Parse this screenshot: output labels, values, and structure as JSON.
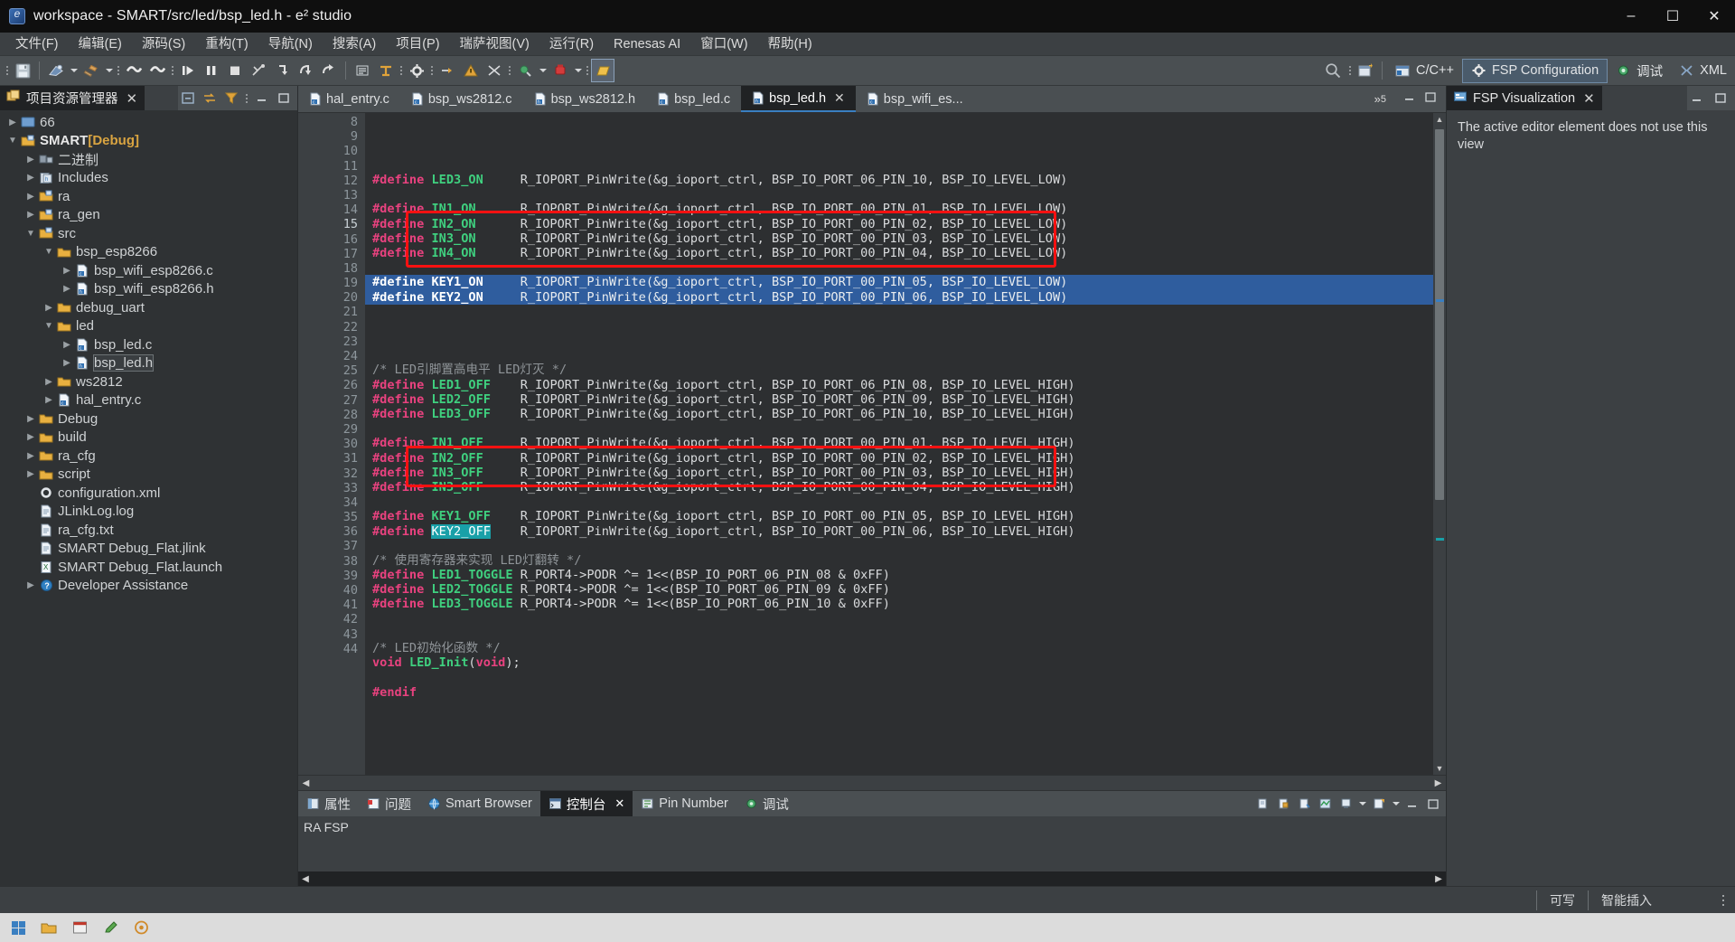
{
  "window": {
    "title": "workspace - SMART/src/led/bsp_led.h - e² studio",
    "minimize": "–",
    "maximize": "☐",
    "close": "✕"
  },
  "menubar": {
    "items": [
      {
        "label": "文件(F)"
      },
      {
        "label": "编辑(E)"
      },
      {
        "label": "源码(S)"
      },
      {
        "label": "重构(T)"
      },
      {
        "label": "导航(N)"
      },
      {
        "label": "搜索(A)"
      },
      {
        "label": "项目(P)"
      },
      {
        "label": "瑞萨视图(V)"
      },
      {
        "label": "运行(R)"
      },
      {
        "label": "Renesas AI"
      },
      {
        "label": "窗口(W)"
      },
      {
        "label": "帮助(H)"
      }
    ]
  },
  "perspectives": [
    {
      "label": "C/C++",
      "icon": "cpp-perspective-icon",
      "active": false
    },
    {
      "label": "FSP Configuration",
      "icon": "gear-icon",
      "active": true
    },
    {
      "label": "调试",
      "icon": "debug-bug-icon",
      "active": false
    },
    {
      "label": "XML",
      "icon": "xml-icon",
      "active": false
    }
  ],
  "project_explorer": {
    "title": "项目资源管理器",
    "close": "✕",
    "tree": [
      {
        "label": "66",
        "depth": 0,
        "arrow": "collapsed",
        "icon": "folder-plain-icon",
        "bold": false
      },
      {
        "label": "SMART",
        "suffix": "[Debug]",
        "depth": 0,
        "arrow": "expanded",
        "icon": "project-icon",
        "bold": true
      },
      {
        "label": "二进制",
        "depth": 1,
        "arrow": "collapsed",
        "icon": "binaries-icon",
        "bold": false
      },
      {
        "label": "Includes",
        "depth": 1,
        "arrow": "collapsed",
        "icon": "includes-icon",
        "bold": false
      },
      {
        "label": "ra",
        "depth": 1,
        "arrow": "collapsed",
        "icon": "source-folder-icon",
        "bold": false
      },
      {
        "label": "ra_gen",
        "depth": 1,
        "arrow": "collapsed",
        "icon": "source-folder-icon",
        "bold": false
      },
      {
        "label": "src",
        "depth": 1,
        "arrow": "expanded",
        "icon": "source-folder-icon",
        "bold": false
      },
      {
        "label": "bsp_esp8266",
        "depth": 2,
        "arrow": "expanded",
        "icon": "folder-icon",
        "bold": false
      },
      {
        "label": "bsp_wifi_esp8266.c",
        "depth": 3,
        "arrow": "collapsed",
        "icon": "c-file-icon",
        "bold": false
      },
      {
        "label": "bsp_wifi_esp8266.h",
        "depth": 3,
        "arrow": "collapsed",
        "icon": "h-file-icon",
        "bold": false
      },
      {
        "label": "debug_uart",
        "depth": 2,
        "arrow": "collapsed",
        "icon": "folder-icon",
        "bold": false
      },
      {
        "label": "led",
        "depth": 2,
        "arrow": "expanded",
        "icon": "folder-icon",
        "bold": false
      },
      {
        "label": "bsp_led.c",
        "depth": 3,
        "arrow": "collapsed",
        "icon": "c-file-icon",
        "bold": false
      },
      {
        "label": "bsp_led.h",
        "depth": 3,
        "arrow": "collapsed",
        "icon": "h-file-icon",
        "bold": false,
        "selected": true
      },
      {
        "label": "ws2812",
        "depth": 2,
        "arrow": "collapsed",
        "icon": "folder-icon",
        "bold": false
      },
      {
        "label": "hal_entry.c",
        "depth": 2,
        "arrow": "collapsed",
        "icon": "c-file-icon",
        "bold": false
      },
      {
        "label": "Debug",
        "depth": 1,
        "arrow": "collapsed",
        "icon": "folder-icon",
        "bold": false
      },
      {
        "label": "build",
        "depth": 1,
        "arrow": "collapsed",
        "icon": "folder-icon",
        "bold": false
      },
      {
        "label": "ra_cfg",
        "depth": 1,
        "arrow": "collapsed",
        "icon": "folder-icon",
        "bold": false
      },
      {
        "label": "script",
        "depth": 1,
        "arrow": "collapsed",
        "icon": "folder-icon",
        "bold": false
      },
      {
        "label": "configuration.xml",
        "depth": 1,
        "arrow": "none",
        "icon": "config-xml-icon",
        "bold": false
      },
      {
        "label": "JLinkLog.log",
        "depth": 1,
        "arrow": "none",
        "icon": "text-file-icon",
        "bold": false
      },
      {
        "label": "ra_cfg.txt",
        "depth": 1,
        "arrow": "none",
        "icon": "text-file-icon",
        "bold": false
      },
      {
        "label": "SMART Debug_Flat.jlink",
        "depth": 1,
        "arrow": "none",
        "icon": "text-file-icon",
        "bold": false
      },
      {
        "label": "SMART Debug_Flat.launch",
        "depth": 1,
        "arrow": "none",
        "icon": "launch-file-icon",
        "bold": false
      },
      {
        "label": "Developer Assistance",
        "depth": 1,
        "arrow": "collapsed",
        "icon": "help-icon",
        "bold": false
      }
    ]
  },
  "editor": {
    "tabs": [
      {
        "label": "hal_entry.c",
        "icon": "c-file-icon",
        "active": false,
        "closable": false
      },
      {
        "label": "bsp_ws2812.c",
        "icon": "c-file-icon",
        "active": false,
        "closable": false
      },
      {
        "label": "bsp_ws2812.h",
        "icon": "h-file-icon",
        "active": false,
        "closable": false
      },
      {
        "label": "bsp_led.c",
        "icon": "c-file-icon",
        "active": false,
        "closable": false
      },
      {
        "label": "bsp_led.h",
        "icon": "h-file-icon",
        "active": true,
        "closable": true
      },
      {
        "label": "bsp_wifi_es...",
        "icon": "c-file-icon",
        "active": false,
        "closable": false
      }
    ],
    "overflow_label": "»",
    "overflow_count": "5",
    "first_line": 8,
    "lines": [
      {
        "n": 8,
        "tokens": [
          {
            "t": "#define",
            "c": "kw-define"
          },
          {
            "t": " ",
            "c": "plain"
          },
          {
            "t": "LED3_ON",
            "c": "macro"
          },
          {
            "t": "     R_IOPORT_PinWrite(&g_ioport_ctrl, BSP_IO_PORT_06_PIN_10, BSP_IO_LEVEL_LOW)",
            "c": "plain"
          }
        ]
      },
      {
        "n": 9,
        "tokens": []
      },
      {
        "n": 10,
        "tokens": [
          {
            "t": "#define",
            "c": "kw-define"
          },
          {
            "t": " ",
            "c": "plain"
          },
          {
            "t": "IN1_ON",
            "c": "macro"
          },
          {
            "t": "      R_IOPORT_PinWrite(&g_ioport_ctrl, BSP_IO_PORT_00_PIN_01, BSP_IO_LEVEL_LOW)",
            "c": "plain"
          }
        ]
      },
      {
        "n": 11,
        "tokens": [
          {
            "t": "#define",
            "c": "kw-define"
          },
          {
            "t": " ",
            "c": "plain"
          },
          {
            "t": "IN2_ON",
            "c": "macro"
          },
          {
            "t": "      R_IOPORT_PinWrite(&g_ioport_ctrl, BSP_IO_PORT_00_PIN_02, BSP_IO_LEVEL_LOW)",
            "c": "plain"
          }
        ]
      },
      {
        "n": 12,
        "tokens": [
          {
            "t": "#define",
            "c": "kw-define"
          },
          {
            "t": " ",
            "c": "plain"
          },
          {
            "t": "IN3_ON",
            "c": "macro"
          },
          {
            "t": "      R_IOPORT_PinWrite(&g_ioport_ctrl, BSP_IO_PORT_00_PIN_03, BSP_IO_LEVEL_LOW)",
            "c": "plain"
          }
        ]
      },
      {
        "n": 13,
        "tokens": [
          {
            "t": "#define",
            "c": "kw-define"
          },
          {
            "t": " ",
            "c": "plain"
          },
          {
            "t": "IN4_ON",
            "c": "macro"
          },
          {
            "t": "      R_IOPORT_PinWrite(&g_ioport_ctrl, BSP_IO_PORT_00_PIN_04, BSP_IO_LEVEL_LOW)",
            "c": "plain"
          }
        ]
      },
      {
        "n": 14,
        "tokens": []
      },
      {
        "n": 15,
        "selected": true,
        "current": true,
        "tokens": [
          {
            "t": "#define",
            "c": "kw-define"
          },
          {
            "t": " ",
            "c": "plain"
          },
          {
            "t": "KEY1_ON",
            "c": "macro"
          },
          {
            "t": "     R_IOPORT_PinWrite(&g_ioport_ctrl, BSP_IO_PORT_00_PIN_05, BSP_IO_LEVEL_LOW)",
            "c": "plain"
          }
        ]
      },
      {
        "n": 16,
        "selected": true,
        "tokens": [
          {
            "t": "#define",
            "c": "kw-define"
          },
          {
            "t": " ",
            "c": "plain"
          },
          {
            "t": "KEY2_ON",
            "c": "macro"
          },
          {
            "t": "     R_IOPORT_PinWrite(&g_ioport_ctrl, BSP_IO_PORT_00_PIN_06, BSP_IO_LEVEL_LOW)",
            "c": "plain"
          }
        ]
      },
      {
        "n": 17,
        "tokens": []
      },
      {
        "n": 18,
        "tokens": []
      },
      {
        "n": 19,
        "tokens": []
      },
      {
        "n": 20,
        "tokens": []
      },
      {
        "n": 21,
        "tokens": [
          {
            "t": "/* LED引脚置高电平 LED灯灭 */",
            "c": "cmt"
          }
        ]
      },
      {
        "n": 22,
        "tokens": [
          {
            "t": "#define",
            "c": "kw-define"
          },
          {
            "t": " ",
            "c": "plain"
          },
          {
            "t": "LED1_OFF",
            "c": "macro"
          },
          {
            "t": "    R_IOPORT_PinWrite(&g_ioport_ctrl, BSP_IO_PORT_06_PIN_08, BSP_IO_LEVEL_HIGH)",
            "c": "plain"
          }
        ]
      },
      {
        "n": 23,
        "tokens": [
          {
            "t": "#define",
            "c": "kw-define"
          },
          {
            "t": " ",
            "c": "plain"
          },
          {
            "t": "LED2_OFF",
            "c": "macro"
          },
          {
            "t": "    R_IOPORT_PinWrite(&g_ioport_ctrl, BSP_IO_PORT_06_PIN_09, BSP_IO_LEVEL_HIGH)",
            "c": "plain"
          }
        ]
      },
      {
        "n": 24,
        "tokens": [
          {
            "t": "#define",
            "c": "kw-define"
          },
          {
            "t": " ",
            "c": "plain"
          },
          {
            "t": "LED3_OFF",
            "c": "macro"
          },
          {
            "t": "    R_IOPORT_PinWrite(&g_ioport_ctrl, BSP_IO_PORT_06_PIN_10, BSP_IO_LEVEL_HIGH)",
            "c": "plain"
          }
        ]
      },
      {
        "n": 25,
        "tokens": []
      },
      {
        "n": 26,
        "tokens": [
          {
            "t": "#define",
            "c": "kw-define"
          },
          {
            "t": " ",
            "c": "plain"
          },
          {
            "t": "IN1_OFF",
            "c": "macro"
          },
          {
            "t": "     R_IOPORT_PinWrite(&g_ioport_ctrl, BSP_IO_PORT_00_PIN_01, BSP_IO_LEVEL_HIGH)",
            "c": "plain"
          }
        ]
      },
      {
        "n": 27,
        "tokens": [
          {
            "t": "#define",
            "c": "kw-define"
          },
          {
            "t": " ",
            "c": "plain"
          },
          {
            "t": "IN2_OFF",
            "c": "macro"
          },
          {
            "t": "     R_IOPORT_PinWrite(&g_ioport_ctrl, BSP_IO_PORT_00_PIN_02, BSP_IO_LEVEL_HIGH)",
            "c": "plain"
          }
        ]
      },
      {
        "n": 28,
        "tokens": [
          {
            "t": "#define",
            "c": "kw-define"
          },
          {
            "t": " ",
            "c": "plain"
          },
          {
            "t": "IN3_OFF",
            "c": "macro"
          },
          {
            "t": "     R_IOPORT_PinWrite(&g_ioport_ctrl, BSP_IO_PORT_00_PIN_03, BSP_IO_LEVEL_HIGH)",
            "c": "plain"
          }
        ]
      },
      {
        "n": 29,
        "tokens": [
          {
            "t": "#define",
            "c": "kw-define"
          },
          {
            "t": " ",
            "c": "plain"
          },
          {
            "t": "IN3_OFF",
            "c": "macro"
          },
          {
            "t": "     R_IOPORT_PinWrite(&g_ioport_ctrl, BSP_IO_PORT_00_PIN_04, BSP_IO_LEVEL_HIGH)",
            "c": "plain"
          }
        ]
      },
      {
        "n": 30,
        "tokens": []
      },
      {
        "n": 31,
        "tokens": [
          {
            "t": "#define",
            "c": "kw-define"
          },
          {
            "t": " ",
            "c": "plain"
          },
          {
            "t": "KEY1_OFF",
            "c": "macro"
          },
          {
            "t": "    R_IOPORT_PinWrite(&g_ioport_ctrl, BSP_IO_PORT_00_PIN_05, BSP_IO_LEVEL_HIGH)",
            "c": "plain"
          }
        ]
      },
      {
        "n": 32,
        "tokens": [
          {
            "t": "#define",
            "c": "kw-define"
          },
          {
            "t": " ",
            "c": "plain"
          },
          {
            "t": "KEY2_OFF",
            "c": "occ"
          },
          {
            "t": "    R_IOPORT_PinWrite(&g_ioport_ctrl, BSP_IO_PORT_00_PIN_06, BSP_IO_LEVEL_HIGH)",
            "c": "plain"
          }
        ]
      },
      {
        "n": 33,
        "tokens": []
      },
      {
        "n": 34,
        "tokens": [
          {
            "t": "/* 使用寄存器来实现 LED灯翻转 */",
            "c": "cmt"
          }
        ]
      },
      {
        "n": 35,
        "tokens": [
          {
            "t": "#define",
            "c": "kw-define"
          },
          {
            "t": " ",
            "c": "plain"
          },
          {
            "t": "LED1_TOGGLE",
            "c": "macro"
          },
          {
            "t": " R_PORT4->PODR ^= 1<<(BSP_IO_PORT_06_PIN_08 & 0xFF)",
            "c": "plain"
          }
        ]
      },
      {
        "n": 36,
        "tokens": [
          {
            "t": "#define",
            "c": "kw-define"
          },
          {
            "t": " ",
            "c": "plain"
          },
          {
            "t": "LED2_TOGGLE",
            "c": "macro"
          },
          {
            "t": " R_PORT4->PODR ^= 1<<(BSP_IO_PORT_06_PIN_09 & 0xFF)",
            "c": "plain"
          }
        ]
      },
      {
        "n": 37,
        "tokens": [
          {
            "t": "#define",
            "c": "kw-define"
          },
          {
            "t": " ",
            "c": "plain"
          },
          {
            "t": "LED3_TOGGLE",
            "c": "macro"
          },
          {
            "t": " R_PORT4->PODR ^= 1<<(BSP_IO_PORT_06_PIN_10 & 0xFF)",
            "c": "plain"
          }
        ]
      },
      {
        "n": 38,
        "tokens": []
      },
      {
        "n": 39,
        "tokens": []
      },
      {
        "n": 40,
        "tokens": [
          {
            "t": "/* LED初始化函数 */",
            "c": "cmt"
          }
        ]
      },
      {
        "n": 41,
        "tokens": [
          {
            "t": "void",
            "c": "kw"
          },
          {
            "t": " ",
            "c": "plain"
          },
          {
            "t": "LED_Init",
            "c": "macro"
          },
          {
            "t": "(",
            "c": "plain"
          },
          {
            "t": "void",
            "c": "kw"
          },
          {
            "t": ");",
            "c": "plain"
          }
        ]
      },
      {
        "n": 42,
        "tokens": []
      },
      {
        "n": 43,
        "tokens": [
          {
            "t": "#endif",
            "c": "kw-define"
          }
        ]
      },
      {
        "n": 44,
        "tokens": []
      }
    ],
    "annotations": [
      {
        "name": "key-on-highlight-box",
        "color": "#fc1111"
      },
      {
        "name": "key-off-highlight-box",
        "color": "#fc1111"
      }
    ]
  },
  "bottom_panel": {
    "tabs": [
      {
        "label": "属性",
        "icon": "properties-icon",
        "active": false,
        "closable": false
      },
      {
        "label": "问题",
        "icon": "problems-icon",
        "active": false,
        "closable": false
      },
      {
        "label": "Smart Browser",
        "icon": "smart-browser-icon",
        "active": false,
        "closable": false
      },
      {
        "label": "控制台",
        "icon": "console-icon",
        "active": true,
        "closable": true
      },
      {
        "label": "Pin Number",
        "icon": "pin-number-icon",
        "active": false,
        "closable": false
      },
      {
        "label": "调试",
        "icon": "debug-bug-icon",
        "active": false,
        "closable": false
      }
    ],
    "console_source": "RA FSP"
  },
  "right_panel": {
    "title": "FSP Visualization",
    "close": "✕",
    "message": "The active editor element does not use this view"
  },
  "statusbar": {
    "writable": "可写",
    "insert_mode": "智能插入"
  },
  "colors": {
    "accent": "#3a7fc1",
    "selection": "#2f5d9e",
    "annotation": "#fc1111",
    "macro_green": "#3fd07f",
    "define_pink": "#e8427f",
    "occurrence": "#19a0a8"
  }
}
